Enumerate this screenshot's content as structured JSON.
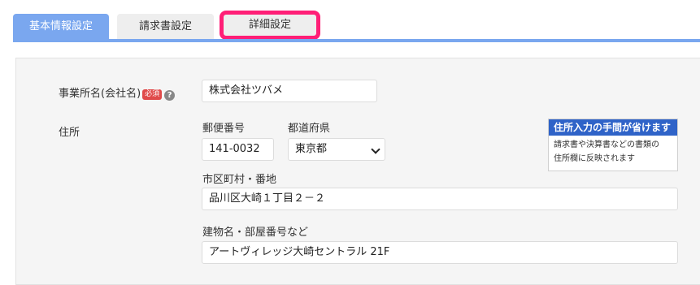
{
  "tabs": {
    "basic": "基本情報設定",
    "invoice": "請求書設定",
    "detail": "詳細設定"
  },
  "form": {
    "company_label": "事業所名(会社名)",
    "required_badge": "必須",
    "help_glyph": "?",
    "company_value": "株式会社ツバメ",
    "address_label": "住所",
    "postal_label": "郵便番号",
    "postal_value": "141-0032",
    "prefecture_label": "都道府県",
    "prefecture_value": "東京都",
    "city_label": "市区町村・番地",
    "city_value": "品川区大崎１丁目２－２",
    "building_label": "建物名・部屋番号など",
    "building_value": "アートヴィレッジ大崎セントラル 21F"
  },
  "hint": {
    "title": "住所入力の手間が省けます",
    "line1": "請求書や決算書などの書類の",
    "line2": "住所欄に反映されます"
  },
  "colors": {
    "active_tab": "#7aa7ef",
    "highlight": "#ff1f77",
    "hint_title_bg": "#2f63c8",
    "required_badge": "#e04a4a"
  }
}
